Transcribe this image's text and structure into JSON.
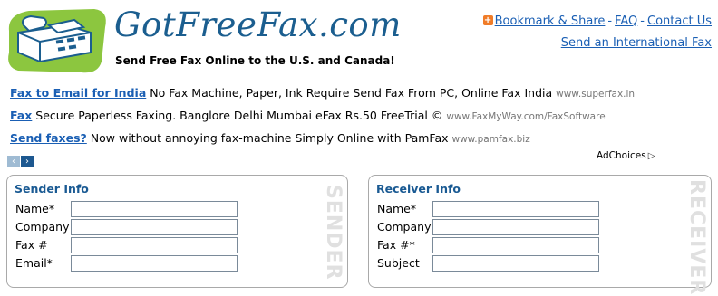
{
  "header": {
    "logo_text": "GotFreeFax.com",
    "tagline": "Send Free Fax Online to the U.S. and Canada!",
    "links": {
      "bookmark": "Bookmark & Share",
      "separator": "-",
      "faq": "FAQ",
      "contact": "Contact Us",
      "international": "Send an International Fax"
    }
  },
  "ads": [
    {
      "title": "Fax to Email for India",
      "desc": "No Fax Machine, Paper, Ink Require Send Fax From PC, Online Fax India",
      "url": "www.superfax.in"
    },
    {
      "title": "Fax",
      "desc": "Secure Paperless Faxing. Banglore Delhi Mumbai eFax Rs.50 FreeTrial ©",
      "url": "www.FaxMyWay.com/FaxSoftware"
    },
    {
      "title": "Send faxes?",
      "desc": "Now without annoying fax-machine Simply Online with PamFax",
      "url": "www.pamfax.biz"
    }
  ],
  "ad_nav": {
    "prev": "‹",
    "next": "›"
  },
  "adchoices": {
    "label": "AdChoices",
    "icon": "▷"
  },
  "sender": {
    "title": "Sender Info",
    "vertical_label": "SENDER",
    "fields": [
      {
        "label": "Name*",
        "value": ""
      },
      {
        "label": "Company",
        "value": ""
      },
      {
        "label": "Fax #",
        "value": ""
      },
      {
        "label": "Email*",
        "value": ""
      }
    ]
  },
  "receiver": {
    "title": "Receiver Info",
    "vertical_label": "RECEIVER",
    "fields": [
      {
        "label": "Name*",
        "value": ""
      },
      {
        "label": "Company",
        "value": ""
      },
      {
        "label": "Fax #*",
        "value": ""
      },
      {
        "label": "Subject",
        "value": ""
      }
    ]
  },
  "colors": {
    "brand": "#1b5e8f",
    "link": "#1a5fb4",
    "logo_green": "#8cc63f"
  }
}
